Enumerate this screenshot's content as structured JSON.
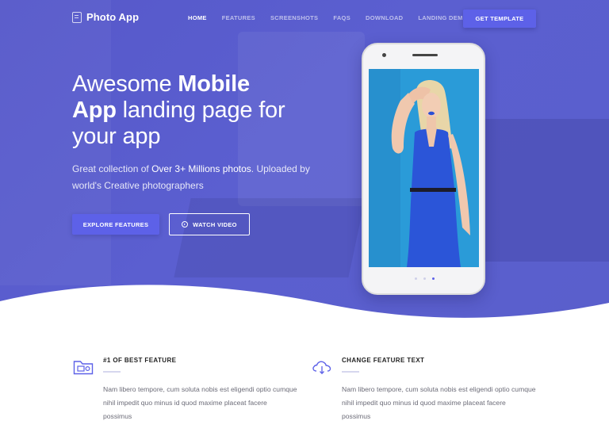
{
  "brand": {
    "name": "Photo App",
    "icon": "notebook-icon"
  },
  "nav": {
    "items": [
      {
        "label": "HOME",
        "active": true
      },
      {
        "label": "FEATURES",
        "active": false
      },
      {
        "label": "SCREENSHOTS",
        "active": false
      },
      {
        "label": "FAQS",
        "active": false
      },
      {
        "label": "DOWNLOAD",
        "active": false
      },
      {
        "label": "LANDING DEMOS",
        "active": false,
        "dropdown": true
      }
    ],
    "cta_label": "GET TEMPLATE"
  },
  "hero": {
    "headline_part1": "Awesome ",
    "headline_bold1": "Mobile",
    "headline_bold2": "App",
    "headline_part2": " landing page for your app",
    "subtext_part1": "Great collection of ",
    "subtext_highlight": "Over 3+ Millions photos",
    "subtext_part2": ". Uploaded by world's Creative photographers",
    "primary_button": "EXPLORE FEATURES",
    "secondary_button": "WATCH VIDEO"
  },
  "features": [
    {
      "icon": "photo-folder-icon",
      "title": "#1 OF BEST FEATURE",
      "text": "Nam libero tempore, cum soluta nobis est eligendi optio cumque nihil impedit quo minus id quod maxime placeat facere possimus"
    },
    {
      "icon": "cloud-download-icon",
      "title": "CHANGE FEATURE TEXT",
      "text": "Nam libero tempore, cum soluta nobis est eligendi optio cumque nihil impedit quo minus id quod maxime placeat facere possimus"
    }
  ],
  "colors": {
    "accent": "#5d61e8",
    "hero_bg": "#5a5ecd",
    "screen_bg": "#2da4de"
  }
}
